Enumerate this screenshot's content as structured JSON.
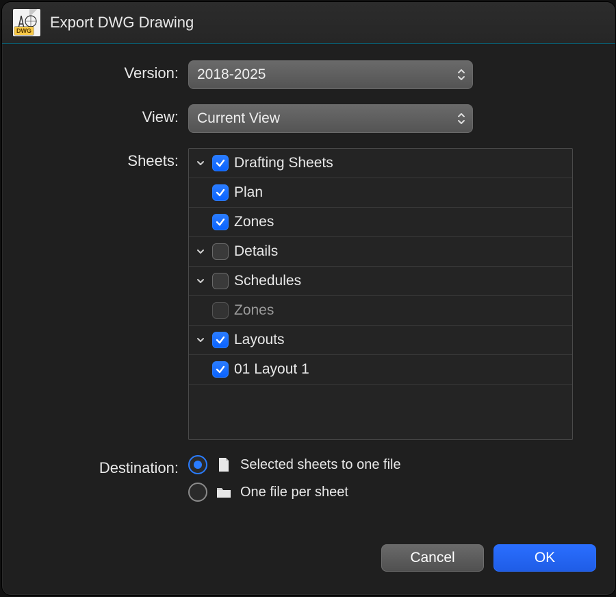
{
  "window": {
    "title": "Export DWG Drawing",
    "icon_tag": "DWG"
  },
  "labels": {
    "version": "Version:",
    "view": "View:",
    "sheets": "Sheets:",
    "destination": "Destination:"
  },
  "version_select": {
    "value": "2018-2025"
  },
  "view_select": {
    "value": "Current View"
  },
  "tree": {
    "groups": [
      {
        "label": "Drafting Sheets",
        "expanded": true,
        "checked": true,
        "children": [
          {
            "label": "Plan",
            "checked": true,
            "disabled": false
          },
          {
            "label": "Zones",
            "checked": true,
            "disabled": false
          }
        ]
      },
      {
        "label": "Details",
        "expanded": true,
        "checked": false,
        "children": []
      },
      {
        "label": "Schedules",
        "expanded": true,
        "checked": false,
        "children": [
          {
            "label": "Zones",
            "checked": false,
            "disabled": true
          }
        ]
      },
      {
        "label": "Layouts",
        "expanded": true,
        "checked": true,
        "children": [
          {
            "label": "01 Layout 1",
            "checked": true,
            "disabled": false
          }
        ]
      }
    ]
  },
  "destination": {
    "selected": 0,
    "options": [
      {
        "label": "Selected sheets to one file",
        "icon": "file"
      },
      {
        "label": "One file per sheet",
        "icon": "folder"
      }
    ]
  },
  "buttons": {
    "cancel": "Cancel",
    "ok": "OK"
  }
}
